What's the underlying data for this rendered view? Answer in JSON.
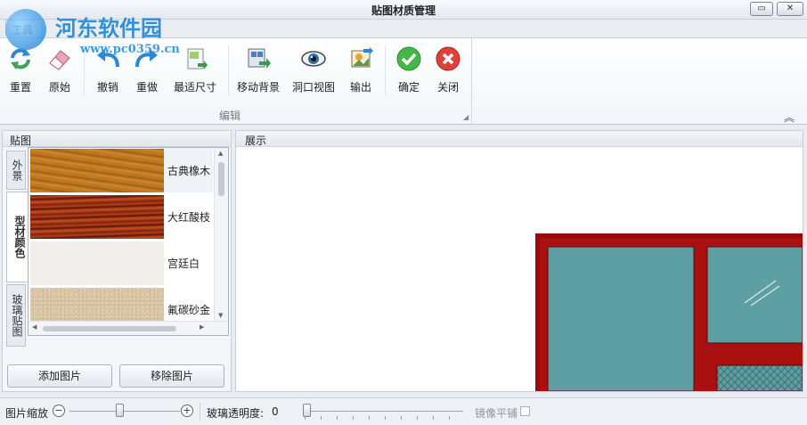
{
  "window": {
    "title": "贴图材质管理",
    "controls": {
      "maximize": "▭",
      "close": "✕"
    }
  },
  "watermark": {
    "name": "河东软件园",
    "url": "www.pc0359.cn"
  },
  "ribbon": {
    "tab": "工具",
    "group_caption": "编辑",
    "buttons": [
      {
        "id": "reset",
        "label": "重置",
        "icon": "refresh-icon"
      },
      {
        "id": "original",
        "label": "原始",
        "icon": "eraser-icon"
      },
      {
        "id": "undo",
        "label": "撤销",
        "icon": "undo-icon"
      },
      {
        "id": "redo",
        "label": "重做",
        "icon": "redo-icon"
      },
      {
        "id": "fit",
        "label": "最适尺寸",
        "icon": "fit-size-icon"
      },
      {
        "id": "move_bg",
        "label": "移动背景",
        "icon": "move-background-icon"
      },
      {
        "id": "hole_view",
        "label": "洞口视图",
        "icon": "eye-icon"
      },
      {
        "id": "export",
        "label": "输出",
        "icon": "export-image-icon"
      },
      {
        "id": "ok",
        "label": "确定",
        "icon": "green-check-icon"
      },
      {
        "id": "close",
        "label": "关闭",
        "icon": "red-close-icon"
      }
    ]
  },
  "left_panel": {
    "title": "贴图",
    "vertical_tabs": [
      "外景",
      "型材颜色",
      "玻璃贴图"
    ],
    "active_tab": "型材颜色",
    "items": [
      {
        "name": "古典橡木",
        "swatch": "oak"
      },
      {
        "name": "大红酸枝",
        "swatch": "rosewood"
      },
      {
        "name": "宫廷白",
        "swatch": "white"
      },
      {
        "name": "氟碳砂金",
        "swatch": "sand"
      }
    ],
    "add_button": "添加图片",
    "remove_button": "移除图片"
  },
  "right_panel": {
    "title": "展示"
  },
  "statusbar": {
    "zoom_label": "图片缩放",
    "zoom_minus": "−",
    "zoom_plus": "+",
    "zoom_level": 0.45,
    "glass_label": "玻璃透明度:",
    "glass_value": "0",
    "mirror_label": "镜像平铺",
    "mirror_checked": false
  },
  "colors": {
    "frame_red": "#9b0a0a",
    "glass_teal": "#5e9fa3"
  }
}
